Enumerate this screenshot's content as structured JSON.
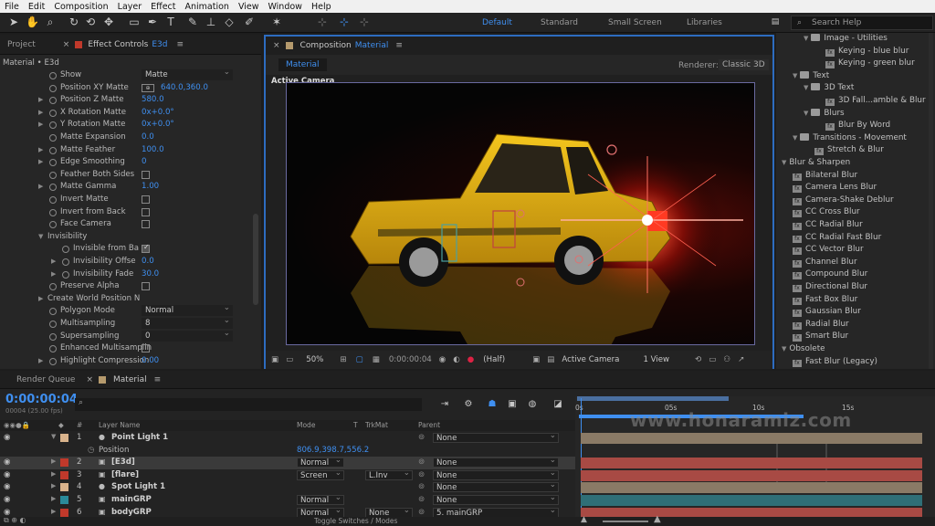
{
  "menu": [
    "File",
    "Edit",
    "Composition",
    "Layer",
    "Effect",
    "Animation",
    "View",
    "Window",
    "Help"
  ],
  "workspaces": {
    "default": "Default",
    "standard": "Standard",
    "small_screen": "Small Screen",
    "libraries": "Libraries"
  },
  "search": {
    "placeholder": "Search Help"
  },
  "left_panel": {
    "tab_project": "Project",
    "tab_effect_controls": "Effect Controls",
    "tab_effect_target": "E3d",
    "breadcrumb": "Material • E3d",
    "rows": [
      {
        "label": "Show",
        "dropdown": "Matte"
      },
      {
        "label": "Position XY Matte",
        "value": "640.0,360.0"
      },
      {
        "label": "Position Z Matte",
        "value": "580.0"
      },
      {
        "label": "X Rotation Matte",
        "value": "0x+0.0°"
      },
      {
        "label": "Y Rotation Matte",
        "value": "0x+0.0°"
      },
      {
        "label": "Matte Expansion",
        "value": "0.0"
      },
      {
        "label": "Matte Feather",
        "value": "100.0"
      },
      {
        "label": "Edge Smoothing",
        "value": "0"
      },
      {
        "label": "Feather Both Sides"
      },
      {
        "label": "Matte Gamma",
        "value": "1.00"
      },
      {
        "label": "Invert Matte"
      },
      {
        "label": "Invert from Back"
      },
      {
        "label": "Face Camera"
      },
      {
        "label": "Invisibility"
      },
      {
        "label": "Invisible from Ba"
      },
      {
        "label": "Invisibility Offse",
        "value": "0.0"
      },
      {
        "label": "Invisibility Fade",
        "value": "30.0"
      },
      {
        "label": "Preserve Alpha"
      },
      {
        "label": "Create World Position N"
      },
      {
        "label": "Polygon Mode",
        "dropdown": "Normal"
      },
      {
        "label": "Multisampling",
        "dropdown": "8"
      },
      {
        "label": "Supersampling",
        "dropdown": "0"
      },
      {
        "label": "Enhanced Multisamplin"
      },
      {
        "label": "Highlight Compression",
        "value": "0.00"
      }
    ]
  },
  "composition": {
    "tab_prefix": "Composition",
    "tab_name": "Material",
    "sub_tab": "Material",
    "renderer_label": "Renderer:",
    "renderer_value": "Classic 3D",
    "viewer_label": "Active Camera",
    "zoom": "50%",
    "timecode": "0:00:00:04",
    "resolution": "(Half)",
    "camera": "Active Camera",
    "views": "1 View"
  },
  "right_panel": {
    "items": [
      {
        "indent": 2,
        "type": "folder",
        "label": "Image - Utilities"
      },
      {
        "indent": 4,
        "type": "fx",
        "label": "Keying - blue blur"
      },
      {
        "indent": 4,
        "type": "fx",
        "label": "Keying - green blur"
      },
      {
        "indent": 1,
        "type": "folder",
        "label": "Text"
      },
      {
        "indent": 2,
        "type": "folder",
        "label": "3D Text"
      },
      {
        "indent": 4,
        "type": "fx",
        "label": "3D Fall...amble & Blur"
      },
      {
        "indent": 2,
        "type": "folder",
        "label": "Blurs"
      },
      {
        "indent": 4,
        "type": "fx",
        "label": "Blur By Word"
      },
      {
        "indent": 1,
        "type": "folder",
        "label": "Transitions - Movement"
      },
      {
        "indent": 3,
        "type": "fx",
        "label": "Stretch & Blur"
      },
      {
        "indent": 0,
        "type": "cat",
        "label": "Blur & Sharpen"
      },
      {
        "indent": 1,
        "type": "fx",
        "label": "Bilateral Blur"
      },
      {
        "indent": 1,
        "type": "fx",
        "label": "Camera Lens Blur"
      },
      {
        "indent": 1,
        "type": "fx",
        "label": "Camera-Shake Deblur"
      },
      {
        "indent": 1,
        "type": "fx",
        "label": "CC Cross Blur"
      },
      {
        "indent": 1,
        "type": "fx",
        "label": "CC Radial Blur"
      },
      {
        "indent": 1,
        "type": "fx",
        "label": "CC Radial Fast Blur"
      },
      {
        "indent": 1,
        "type": "fx",
        "label": "CC Vector Blur"
      },
      {
        "indent": 1,
        "type": "fx",
        "label": "Channel Blur"
      },
      {
        "indent": 1,
        "type": "fx",
        "label": "Compound Blur"
      },
      {
        "indent": 1,
        "type": "fx",
        "label": "Directional Blur"
      },
      {
        "indent": 1,
        "type": "fx",
        "label": "Fast Box Blur"
      },
      {
        "indent": 1,
        "type": "fx",
        "label": "Gaussian Blur"
      },
      {
        "indent": 1,
        "type": "fx",
        "label": "Radial Blur"
      },
      {
        "indent": 1,
        "type": "fx",
        "label": "Smart Blur"
      },
      {
        "indent": 0,
        "type": "cat",
        "label": "Obsolete"
      },
      {
        "indent": 1,
        "type": "fx",
        "label": "Fast Blur (Legacy)"
      }
    ]
  },
  "timeline": {
    "tab_render_queue": "Render Queue",
    "tab_material": "Material",
    "timecode": "0:00:00:04",
    "frame_info": "00004 (25.00 fps)",
    "headers": {
      "layer_name": "Layer Name",
      "mode": "Mode",
      "t": "T",
      "trkmat": "TrkMat",
      "parent": "Parent"
    },
    "ruler": {
      "t0": "0s",
      "t1": "05s",
      "t2": "10s",
      "t3": "15s"
    },
    "footer": "Toggle Switches / Modes",
    "watermark": "www.honaramiz.com",
    "layers": [
      {
        "num": "1",
        "name": "Point Light 1",
        "color": "#d9b38c",
        "mode": "",
        "trkmat": "",
        "parent": "None",
        "bar": "#8a7a66"
      },
      {
        "num": "",
        "name": "Position",
        "color": "",
        "mode": "",
        "trkmat": "",
        "parent": "",
        "value": "806.9,398.7,556.2",
        "bar": ""
      },
      {
        "num": "2",
        "name": "[E3d]",
        "color": "#c0392b",
        "mode": "Normal",
        "trkmat": "",
        "parent": "None",
        "bar": "#a84a44"
      },
      {
        "num": "3",
        "name": "[flare]",
        "color": "#c0392b",
        "mode": "Screen",
        "trkmat": "L.Inv",
        "parent": "None",
        "bar": "#a84a44"
      },
      {
        "num": "4",
        "name": "Spot Light 1",
        "color": "#d9b38c",
        "mode": "",
        "trkmat": "",
        "parent": "None",
        "bar": "#8a7a66"
      },
      {
        "num": "5",
        "name": "mainGRP",
        "color": "#2b8a99",
        "mode": "Normal",
        "trkmat": "",
        "parent": "None",
        "bar": "#2f6f77"
      },
      {
        "num": "6",
        "name": "bodyGRP",
        "color": "#c0392b",
        "mode": "Normal",
        "trkmat": "None",
        "parent": "5. mainGRP",
        "bar": "#a84a44"
      }
    ]
  }
}
